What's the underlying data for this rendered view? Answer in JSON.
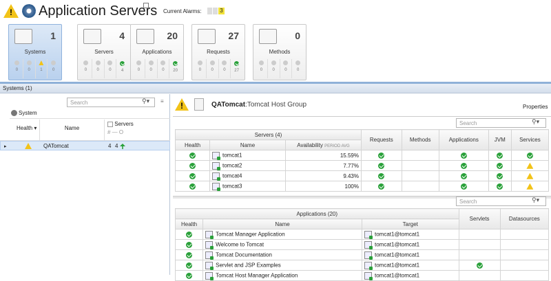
{
  "header": {
    "title": "Application Servers",
    "alarms_label": "Current Alarms:",
    "alarm_count": "3"
  },
  "tiles": [
    {
      "name": "Systems",
      "count": "1",
      "stats": [
        "0",
        "0",
        "1",
        "0"
      ],
      "selected": true
    },
    {
      "name": "Servers",
      "count": "4",
      "stats": [
        "0",
        "0",
        "0",
        "4"
      ],
      "selected": false
    },
    {
      "name": "Applications",
      "count": "20",
      "stats": [
        "0",
        "0",
        "0",
        "20"
      ],
      "selected": false
    },
    {
      "name": "Requests",
      "count": "27",
      "stats": [
        "0",
        "0",
        "0",
        "27"
      ],
      "selected": false
    },
    {
      "name": "Methods",
      "count": "0",
      "stats": [
        "0",
        "0",
        "0",
        "0"
      ],
      "selected": false
    }
  ],
  "systems_bar": "Systems (1)",
  "left_panel": {
    "search_placeholder": "Search",
    "group_label": "System",
    "col_health": "Health",
    "col_name": "Name",
    "col_servers": "Servers",
    "col_sub": "# — O",
    "row": {
      "name": "QATomcat",
      "servers_a": "4",
      "servers_b": "4"
    }
  },
  "right_panel": {
    "host_name": "QATomcat",
    "host_type": ":Tomcat Host Group",
    "properties": "Properties",
    "search_placeholder": "Search",
    "servers_header": "Servers (4)",
    "cols": {
      "health": "Health",
      "name": "Name",
      "availability": "Availability",
      "period": "PERIOD AVG",
      "requests": "Requests",
      "methods": "Methods",
      "applications": "Applications",
      "jvm": "JVM",
      "services": "Services"
    },
    "servers": [
      {
        "name": "tomcat1",
        "avail": "15.59%",
        "services": "ok"
      },
      {
        "name": "tomcat2",
        "avail": "7.77%",
        "services": "warn"
      },
      {
        "name": "tomcat4",
        "avail": "9.43%",
        "services": "warn"
      },
      {
        "name": "tomcat3",
        "avail": "100%",
        "services": "warn"
      }
    ],
    "apps_search_placeholder": "Search",
    "apps_header": "Applications (20)",
    "apps_cols": {
      "health": "Health",
      "name": "Name",
      "target": "Target",
      "servlets": "Servlets",
      "datasources": "Datasources"
    },
    "apps": [
      {
        "name": "Tomcat Manager Application",
        "target": "tomcat1@tomcat1",
        "servlets": false
      },
      {
        "name": "Welcome to Tomcat",
        "target": "tomcat1@tomcat1",
        "servlets": false
      },
      {
        "name": "Tomcat Documentation",
        "target": "tomcat1@tomcat1",
        "servlets": false
      },
      {
        "name": "Servlet and JSP Examples",
        "target": "tomcat1@tomcat1",
        "servlets": true
      },
      {
        "name": "Tomcat Host Manager Application",
        "target": "tomcat1@tomcat1",
        "servlets": false
      }
    ]
  }
}
